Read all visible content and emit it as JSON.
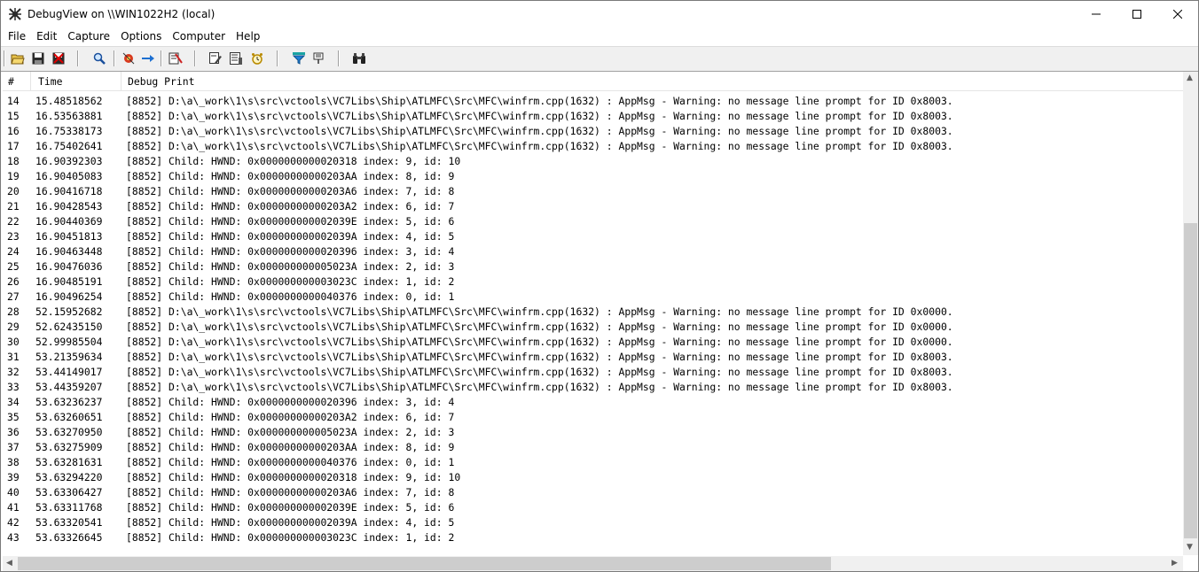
{
  "window": {
    "title": "DebugView on \\\\WIN1022H2 (local)"
  },
  "menu": [
    "File",
    "Edit",
    "Capture",
    "Options",
    "Computer",
    "Help"
  ],
  "columns": {
    "num": "#",
    "time": "Time",
    "message": "Debug Print"
  },
  "rows": [
    {
      "num": "14",
      "time": "15.48518562",
      "msg": "[8852] D:\\a\\_work\\1\\s\\src\\vctools\\VC7Libs\\Ship\\ATLMFC\\Src\\MFC\\winfrm.cpp(1632) : AppMsg - Warning: no message line prompt for ID 0x8003."
    },
    {
      "num": "15",
      "time": "16.53563881",
      "msg": "[8852] D:\\a\\_work\\1\\s\\src\\vctools\\VC7Libs\\Ship\\ATLMFC\\Src\\MFC\\winfrm.cpp(1632) : AppMsg - Warning: no message line prompt for ID 0x8003."
    },
    {
      "num": "16",
      "time": "16.75338173",
      "msg": "[8852] D:\\a\\_work\\1\\s\\src\\vctools\\VC7Libs\\Ship\\ATLMFC\\Src\\MFC\\winfrm.cpp(1632) : AppMsg - Warning: no message line prompt for ID 0x8003."
    },
    {
      "num": "17",
      "time": "16.75402641",
      "msg": "[8852] D:\\a\\_work\\1\\s\\src\\vctools\\VC7Libs\\Ship\\ATLMFC\\Src\\MFC\\winfrm.cpp(1632) : AppMsg - Warning: no message line prompt for ID 0x8003."
    },
    {
      "num": "18",
      "time": "16.90392303",
      "msg": "[8852] Child: HWND: 0x0000000000020318 index: 9, id: 10"
    },
    {
      "num": "19",
      "time": "16.90405083",
      "msg": "[8852] Child: HWND: 0x00000000000203AA index: 8, id: 9"
    },
    {
      "num": "20",
      "time": "16.90416718",
      "msg": "[8852] Child: HWND: 0x00000000000203A6 index: 7, id: 8"
    },
    {
      "num": "21",
      "time": "16.90428543",
      "msg": "[8852] Child: HWND: 0x00000000000203A2 index: 6, id: 7"
    },
    {
      "num": "22",
      "time": "16.90440369",
      "msg": "[8852] Child: HWND: 0x000000000002039E index: 5, id: 6"
    },
    {
      "num": "23",
      "time": "16.90451813",
      "msg": "[8852] Child: HWND: 0x000000000002039A index: 4, id: 5"
    },
    {
      "num": "24",
      "time": "16.90463448",
      "msg": "[8852] Child: HWND: 0x0000000000020396 index: 3, id: 4"
    },
    {
      "num": "25",
      "time": "16.90476036",
      "msg": "[8852] Child: HWND: 0x000000000005023A index: 2, id: 3"
    },
    {
      "num": "26",
      "time": "16.90485191",
      "msg": "[8852] Child: HWND: 0x000000000003023C index: 1, id: 2"
    },
    {
      "num": "27",
      "time": "16.90496254",
      "msg": "[8852] Child: HWND: 0x0000000000040376 index: 0, id: 1"
    },
    {
      "num": "28",
      "time": "52.15952682",
      "msg": "[8852] D:\\a\\_work\\1\\s\\src\\vctools\\VC7Libs\\Ship\\ATLMFC\\Src\\MFC\\winfrm.cpp(1632) : AppMsg - Warning: no message line prompt for ID 0x0000."
    },
    {
      "num": "29",
      "time": "52.62435150",
      "msg": "[8852] D:\\a\\_work\\1\\s\\src\\vctools\\VC7Libs\\Ship\\ATLMFC\\Src\\MFC\\winfrm.cpp(1632) : AppMsg - Warning: no message line prompt for ID 0x0000."
    },
    {
      "num": "30",
      "time": "52.99985504",
      "msg": "[8852] D:\\a\\_work\\1\\s\\src\\vctools\\VC7Libs\\Ship\\ATLMFC\\Src\\MFC\\winfrm.cpp(1632) : AppMsg - Warning: no message line prompt for ID 0x0000."
    },
    {
      "num": "31",
      "time": "53.21359634",
      "msg": "[8852] D:\\a\\_work\\1\\s\\src\\vctools\\VC7Libs\\Ship\\ATLMFC\\Src\\MFC\\winfrm.cpp(1632) : AppMsg - Warning: no message line prompt for ID 0x8003."
    },
    {
      "num": "32",
      "time": "53.44149017",
      "msg": "[8852] D:\\a\\_work\\1\\s\\src\\vctools\\VC7Libs\\Ship\\ATLMFC\\Src\\MFC\\winfrm.cpp(1632) : AppMsg - Warning: no message line prompt for ID 0x8003."
    },
    {
      "num": "33",
      "time": "53.44359207",
      "msg": "[8852] D:\\a\\_work\\1\\s\\src\\vctools\\VC7Libs\\Ship\\ATLMFC\\Src\\MFC\\winfrm.cpp(1632) : AppMsg - Warning: no message line prompt for ID 0x8003."
    },
    {
      "num": "34",
      "time": "53.63236237",
      "msg": "[8852] Child: HWND: 0x0000000000020396 index: 3, id: 4"
    },
    {
      "num": "35",
      "time": "53.63260651",
      "msg": "[8852] Child: HWND: 0x00000000000203A2 index: 6, id: 7"
    },
    {
      "num": "36",
      "time": "53.63270950",
      "msg": "[8852] Child: HWND: 0x000000000005023A index: 2, id: 3"
    },
    {
      "num": "37",
      "time": "53.63275909",
      "msg": "[8852] Child: HWND: 0x00000000000203AA index: 8, id: 9"
    },
    {
      "num": "38",
      "time": "53.63281631",
      "msg": "[8852] Child: HWND: 0x0000000000040376 index: 0, id: 1"
    },
    {
      "num": "39",
      "time": "53.63294220",
      "msg": "[8852] Child: HWND: 0x0000000000020318 index: 9, id: 10"
    },
    {
      "num": "40",
      "time": "53.63306427",
      "msg": "[8852] Child: HWND: 0x00000000000203A6 index: 7, id: 8"
    },
    {
      "num": "41",
      "time": "53.63311768",
      "msg": "[8852] Child: HWND: 0x000000000002039E index: 5, id: 6"
    },
    {
      "num": "42",
      "time": "53.63320541",
      "msg": "[8852] Child: HWND: 0x000000000002039A index: 4, id: 5"
    },
    {
      "num": "43",
      "time": "53.63326645",
      "msg": "[8852] Child: HWND: 0x000000000003023C index: 1, id: 2"
    }
  ]
}
